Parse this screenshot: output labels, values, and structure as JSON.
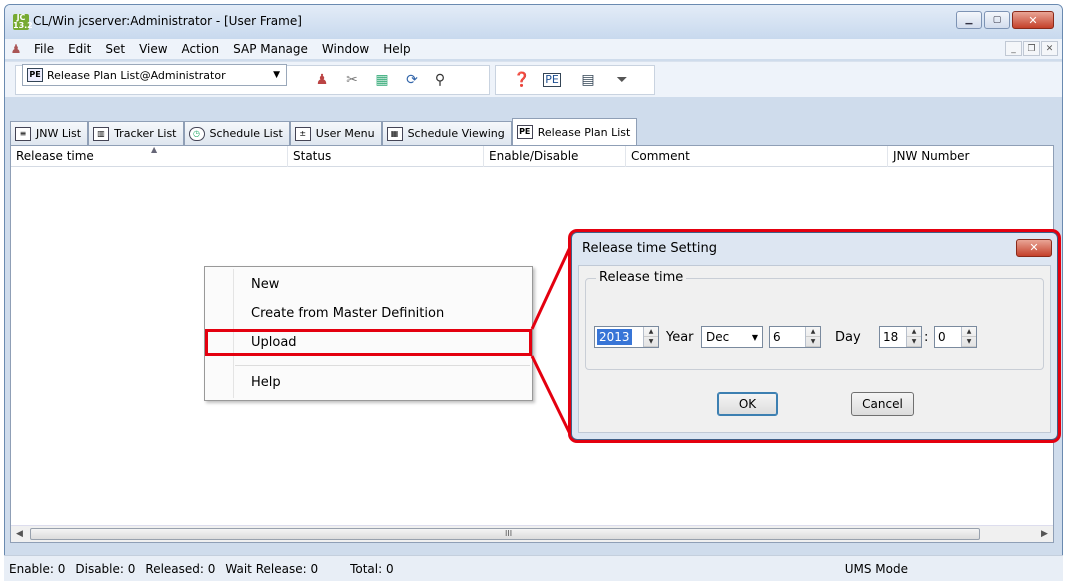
{
  "window": {
    "title": "CL/Win jcserver:Administrator - [User Frame]",
    "app_icon_top": "JC",
    "app_icon_bottom": "13.2",
    "controls": [
      "minimize",
      "maximize",
      "close"
    ]
  },
  "menubar": {
    "items": [
      "File",
      "Edit",
      "Set",
      "View",
      "Action",
      "SAP Manage",
      "Window",
      "Help"
    ]
  },
  "toolbar": {
    "combo_value": "Release Plan List@Administrator"
  },
  "tabs": [
    {
      "label": "JNW List",
      "icon": "jnw-list-icon"
    },
    {
      "label": "Tracker List",
      "icon": "tracker-list-icon"
    },
    {
      "label": "Schedule List",
      "icon": "schedule-list-icon"
    },
    {
      "label": "User Menu",
      "icon": "user-menu-icon"
    },
    {
      "label": "Schedule Viewing",
      "icon": "schedule-viewing-icon"
    },
    {
      "label": "Release Plan List",
      "icon": "release-plan-list-icon",
      "active": true
    }
  ],
  "table": {
    "columns": [
      "Release time",
      "Status",
      "Enable/Disable",
      "Comment",
      "JNW Number"
    ]
  },
  "context_menu": {
    "items": [
      "New",
      "Create from Master Definition",
      "Upload",
      "Help"
    ],
    "highlighted": "Upload"
  },
  "dialog": {
    "title": "Release time Setting",
    "group_label": "Release time",
    "year_value": "2013",
    "year_label": "Year",
    "month_value": "Dec",
    "day_value": "6",
    "day_label": "Day",
    "hour_value": "18",
    "time_sep": ":",
    "minute_value": "0",
    "ok_label": "OK",
    "cancel_label": "Cancel"
  },
  "scrollbar": {
    "grip": "III"
  },
  "statusbar": {
    "enable": "Enable: 0",
    "disable": "Disable: 0",
    "released": "Released: 0",
    "wait_release": "Wait Release: 0",
    "total": "Total: 0",
    "mode": "UMS Mode"
  },
  "colors": {
    "callout": "#e4000f",
    "selection": "#3875d7"
  }
}
